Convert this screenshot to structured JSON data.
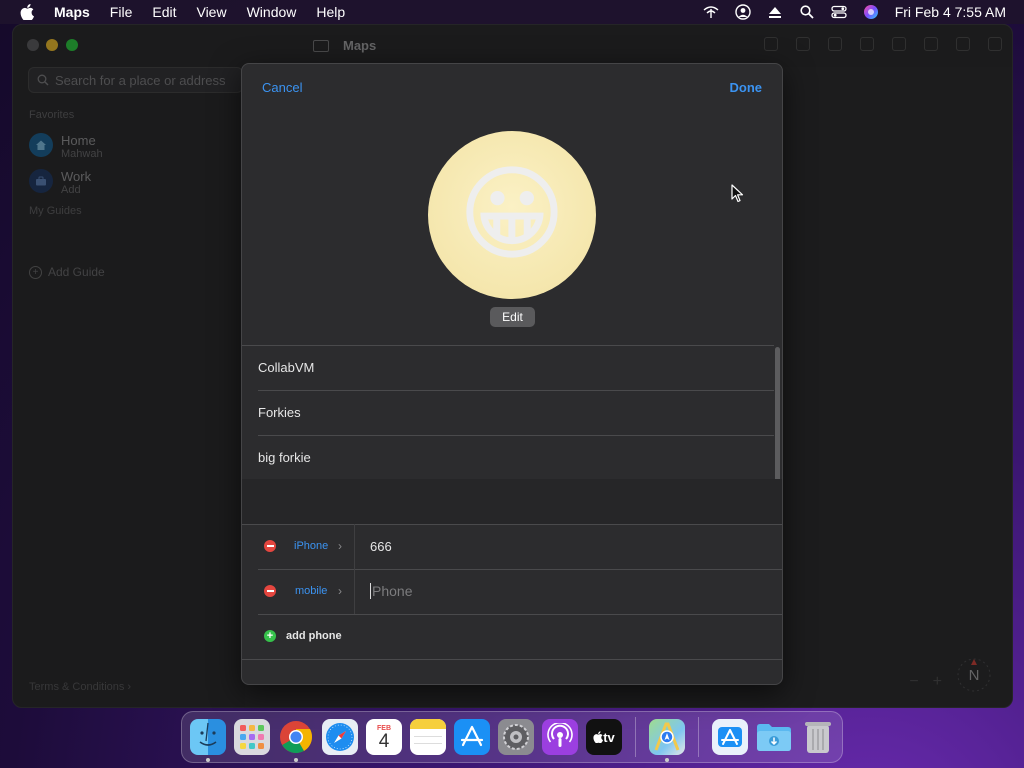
{
  "menubar": {
    "app_name": "Maps",
    "items": [
      "File",
      "Edit",
      "View",
      "Window",
      "Help"
    ],
    "clock": "Fri Feb 4  7:55 AM"
  },
  "window": {
    "title": "Maps",
    "search_placeholder": "Search for a place or address",
    "sidebar": {
      "favorites_header": "Favorites",
      "favorites": [
        {
          "name": "Home",
          "sub": "Mahwah"
        },
        {
          "name": "Work",
          "sub": "Add"
        }
      ],
      "guides_header": "My Guides",
      "add_guide": "Add Guide",
      "terms": "Terms & Conditions"
    },
    "compass": "N",
    "zoom_out": "−",
    "zoom_in": "+"
  },
  "sheet": {
    "cancel": "Cancel",
    "done": "Done",
    "avatar_emoji": "😀",
    "edit_label": "Edit",
    "name_fields": [
      "CollabVM",
      "Forkies",
      "big forkie"
    ],
    "phones": [
      {
        "label": "iPhone",
        "value": "666"
      },
      {
        "label": "mobile",
        "placeholder": "Phone"
      }
    ],
    "add_phone": "add phone"
  },
  "dock": {
    "calendar_month": "FEB",
    "calendar_day": "4",
    "tv_label": "tv"
  }
}
